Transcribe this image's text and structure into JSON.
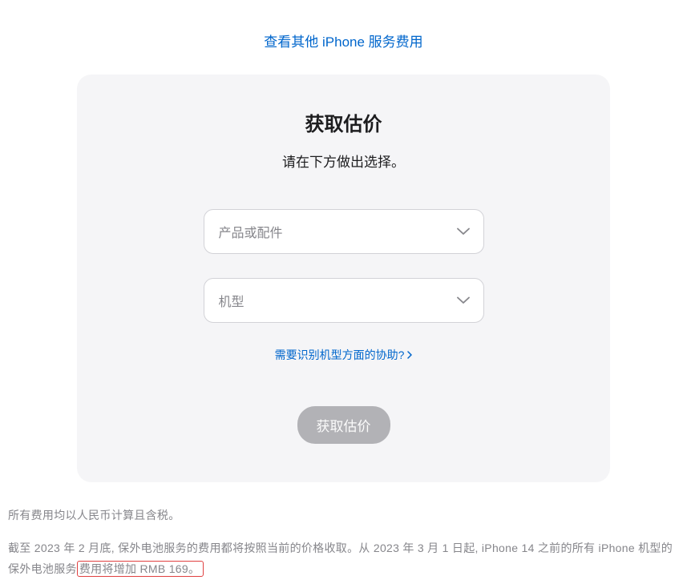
{
  "top_link": {
    "label": "查看其他 iPhone 服务费用"
  },
  "card": {
    "title": "获取估价",
    "subtitle": "请在下方做出选择。",
    "select_product_placeholder": "产品或配件",
    "select_model_placeholder": "机型",
    "help_label": "需要识别机型方面的协助?",
    "cta_label": "获取估价"
  },
  "footer": {
    "line1": "所有费用均以人民币计算且含税。",
    "line2_pre": "截至 2023 年 2 月底, 保外电池服务的费用都将按照当前的价格收取。从 2023 年 3 月 1 日起, iPhone 14 之前的所有 iPhone 机型的保外电池服务",
    "line2_box": "费用将增加 RMB 169。"
  }
}
